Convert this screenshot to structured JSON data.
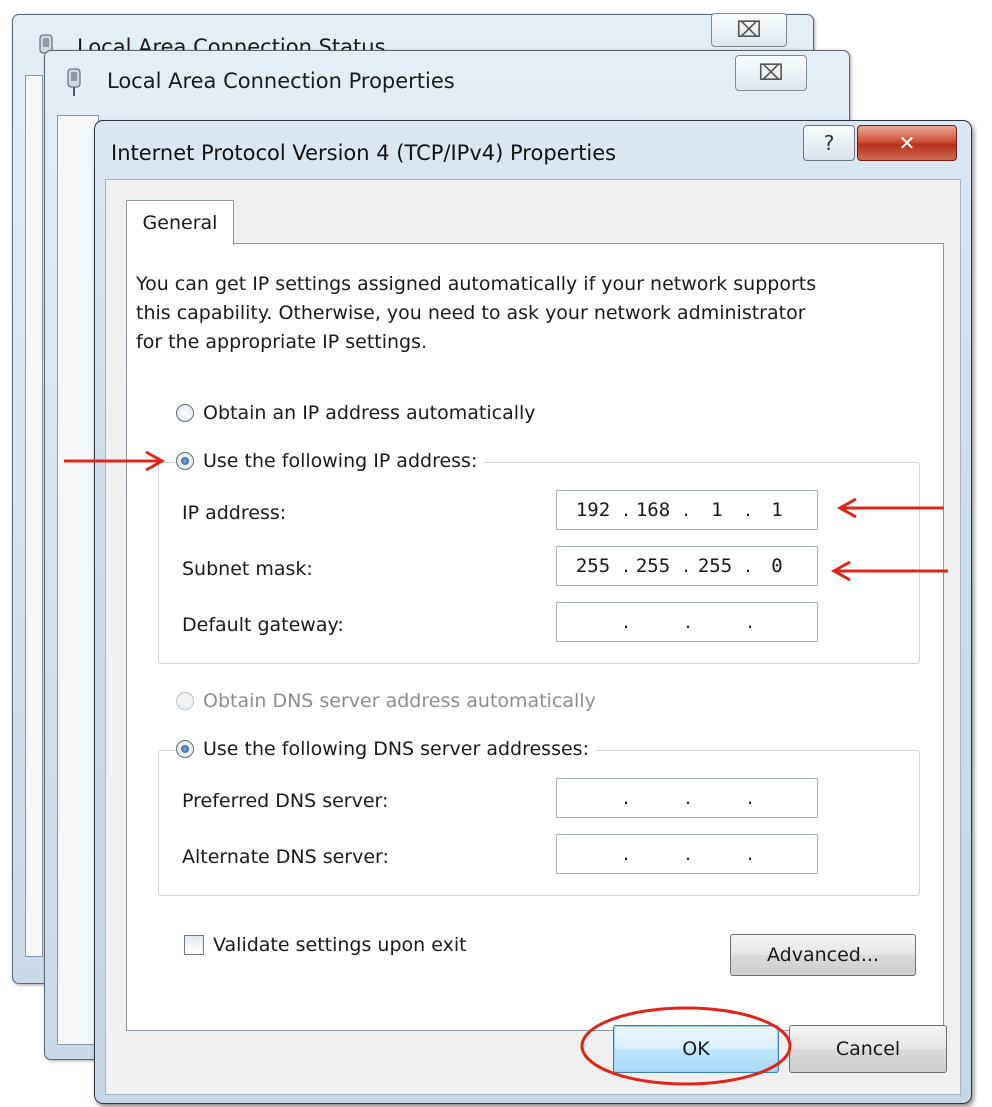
{
  "background_windows": {
    "status_title": "Local Area Connection Status",
    "properties_title": "Local Area Connection Properties",
    "close_glyph": "⌧"
  },
  "dialog": {
    "title": "Internet Protocol Version 4 (TCP/IPv4) Properties",
    "help_glyph": "?",
    "close_glyph": "✕"
  },
  "tabs": [
    {
      "label": "General",
      "selected": true
    }
  ],
  "intro_lines": [
    "You can get IP settings assigned automatically if your network supports",
    "this capability. Otherwise, you need to ask your network administrator",
    "for the appropriate IP settings."
  ],
  "ip_mode": {
    "auto_label": "Obtain an IP address automatically",
    "auto_selected": false,
    "manual_label": "Use the following IP address:",
    "manual_selected": true
  },
  "ip_fields": {
    "ip_address": {
      "label": "IP address:",
      "octets": [
        "192",
        "168",
        "1",
        "1"
      ]
    },
    "subnet_mask": {
      "label": "Subnet mask:",
      "octets": [
        "255",
        "255",
        "255",
        "0"
      ]
    },
    "default_gateway": {
      "label": "Default gateway:",
      "octets": [
        "",
        "",
        "",
        ""
      ]
    }
  },
  "dns_mode": {
    "auto_label": "Obtain DNS server address automatically",
    "auto_disabled": true,
    "manual_label": "Use the following DNS server addresses:",
    "manual_selected": true
  },
  "dns_fields": {
    "preferred": {
      "label": "Preferred DNS server:",
      "octets": [
        "",
        "",
        "",
        ""
      ]
    },
    "alternate": {
      "label": "Alternate DNS server:",
      "octets": [
        "",
        "",
        "",
        ""
      ]
    }
  },
  "validate": {
    "label": "Validate settings upon exit",
    "checked": false
  },
  "buttons": {
    "advanced": "Advanced...",
    "ok": "OK",
    "cancel": "Cancel"
  },
  "colors": {
    "annotation_red": "#e0241b",
    "close_red": "#c8412b",
    "window_blue": "#cddcec"
  },
  "icons": {
    "connection": "network-connection-icon"
  }
}
